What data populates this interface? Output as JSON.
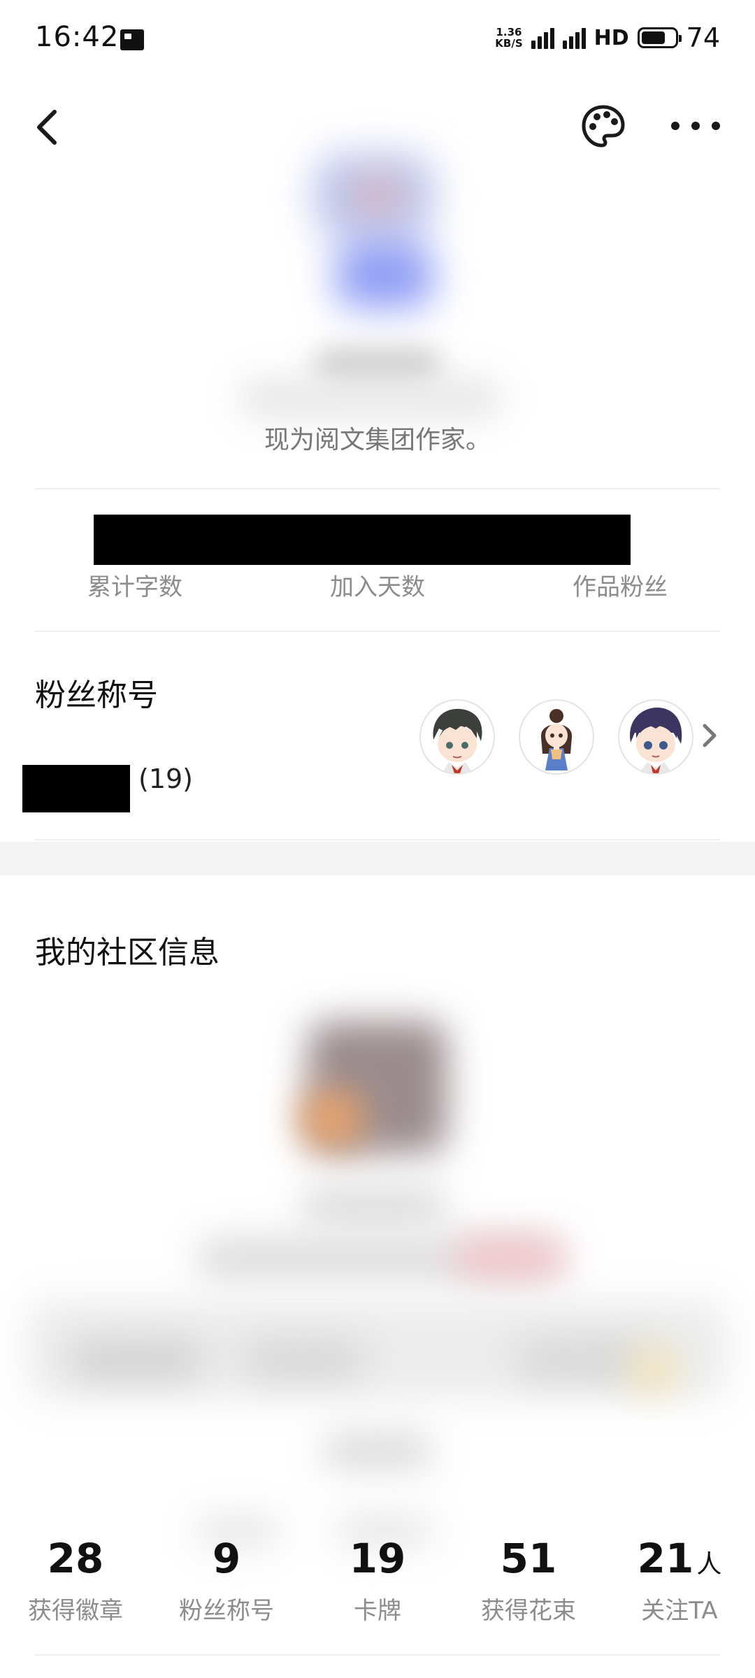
{
  "status_bar": {
    "time": "16:42",
    "speed_top": "1.36",
    "speed_bottom": "KB/S",
    "signal_tag": "4G",
    "hd_label": "HD",
    "battery_level": "74"
  },
  "nav": {
    "back_icon": "chevron-left-icon",
    "theme_icon": "palette-icon",
    "more_icon": "more-horizontal-icon"
  },
  "profile": {
    "description": "现为阅文集团作家。"
  },
  "author_stats": {
    "labels": [
      "累计字数",
      "加入天数",
      "作品粉丝"
    ]
  },
  "fan_titles": {
    "title": "粉丝称号",
    "count": "(19)"
  },
  "community": {
    "title": "我的社区信息"
  },
  "community_stats": [
    {
      "value": "28",
      "unit": "",
      "label": "获得徽章"
    },
    {
      "value": "9",
      "unit": "",
      "label": "粉丝称号"
    },
    {
      "value": "19",
      "unit": "",
      "label": "卡牌"
    },
    {
      "value": "51",
      "unit": "",
      "label": "获得花束"
    },
    {
      "value": "21",
      "unit": "人",
      "label": "关注TA"
    }
  ],
  "colors": {
    "muted_text": "#8c8c8c",
    "section_band": "#f3f3f3",
    "redaction": "#000000"
  }
}
